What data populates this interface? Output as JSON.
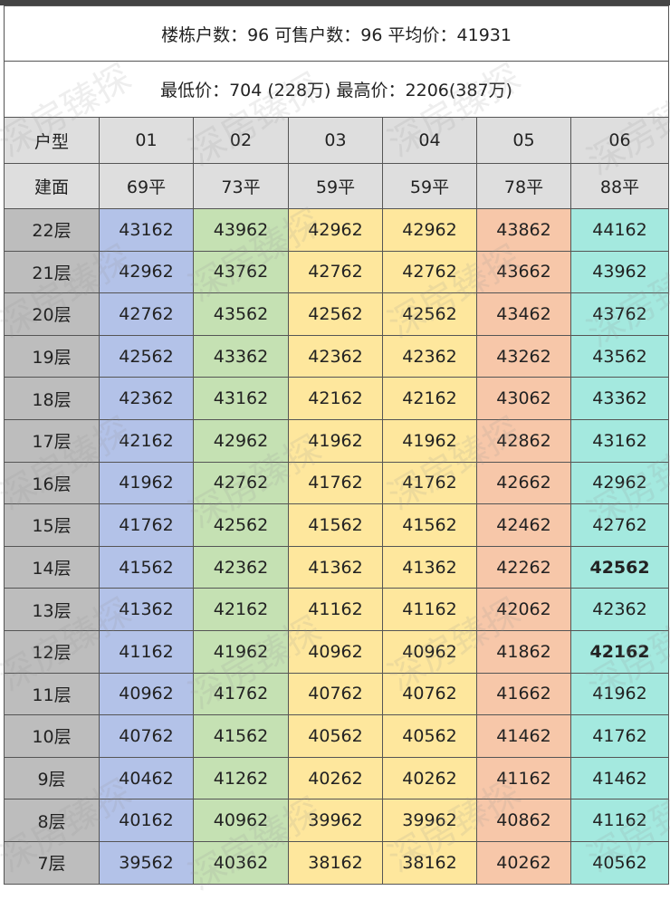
{
  "info": {
    "line1": "楼栋户数：96 可售户数：96 平均价：41931",
    "line2": "最低价：704 (228万) 最高价：2206(387万)"
  },
  "header": {
    "type_label": "户型",
    "area_label": "建面",
    "units": [
      "01",
      "02",
      "03",
      "04",
      "05",
      "06"
    ],
    "areas": [
      "69平",
      "73平",
      "59平",
      "59平",
      "78平",
      "88平"
    ]
  },
  "unit_colors": [
    "#b3c2e8",
    "#c5e1b3",
    "#fee79d",
    "#fee79d",
    "#f7c7a9",
    "#a4e9df"
  ],
  "watermark": "深房臻探",
  "rows": [
    {
      "floor": "22层",
      "prices": [
        "43162",
        "43962",
        "42962",
        "42962",
        "43862",
        "44162"
      ]
    },
    {
      "floor": "21层",
      "prices": [
        "42962",
        "43762",
        "42762",
        "42762",
        "43662",
        "43962"
      ]
    },
    {
      "floor": "20层",
      "prices": [
        "42762",
        "43562",
        "42562",
        "42562",
        "43462",
        "43762"
      ]
    },
    {
      "floor": "19层",
      "prices": [
        "42562",
        "43362",
        "42362",
        "42362",
        "43262",
        "43562"
      ]
    },
    {
      "floor": "18层",
      "prices": [
        "42362",
        "43162",
        "42162",
        "42162",
        "43062",
        "43362"
      ]
    },
    {
      "floor": "17层",
      "prices": [
        "42162",
        "42962",
        "41962",
        "41962",
        "42862",
        "43162"
      ]
    },
    {
      "floor": "16层",
      "prices": [
        "41962",
        "42762",
        "41762",
        "41762",
        "42662",
        "42962"
      ]
    },
    {
      "floor": "15层",
      "prices": [
        "41762",
        "42562",
        "41562",
        "41562",
        "42462",
        "42762"
      ]
    },
    {
      "floor": "14层",
      "prices": [
        "41562",
        "42362",
        "41362",
        "41362",
        "42262",
        "42562"
      ],
      "bold": [
        5
      ]
    },
    {
      "floor": "13层",
      "prices": [
        "41362",
        "42162",
        "41162",
        "41162",
        "42062",
        "42362"
      ]
    },
    {
      "floor": "12层",
      "prices": [
        "41162",
        "41962",
        "40962",
        "40962",
        "41862",
        "42162"
      ],
      "bold": [
        5
      ]
    },
    {
      "floor": "11层",
      "prices": [
        "40962",
        "41762",
        "40762",
        "40762",
        "41662",
        "41962"
      ]
    },
    {
      "floor": "10层",
      "prices": [
        "40762",
        "41562",
        "40562",
        "40562",
        "41462",
        "41762"
      ]
    },
    {
      "floor": "9层",
      "prices": [
        "40462",
        "41262",
        "40262",
        "40262",
        "41162",
        "41462"
      ]
    },
    {
      "floor": "8层",
      "prices": [
        "40162",
        "40962",
        "39962",
        "39962",
        "40862",
        "41162"
      ]
    },
    {
      "floor": "7层",
      "prices": [
        "39562",
        "40362",
        "38162",
        "38162",
        "40262",
        "40562"
      ]
    }
  ]
}
